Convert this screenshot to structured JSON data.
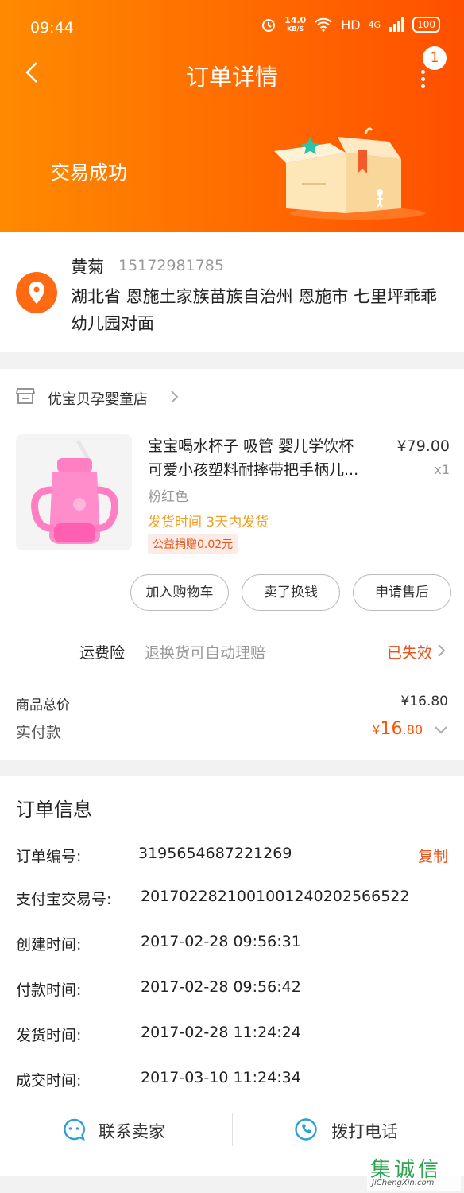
{
  "status_bar": {
    "time": "09:44",
    "speed_value": "14.0",
    "speed_unit": "KB/S",
    "hd": "HD",
    "network": "4G",
    "battery": "100"
  },
  "nav": {
    "title": "订单详情",
    "badge_count": "1"
  },
  "header": {
    "trade_status": "交易成功"
  },
  "address": {
    "name": "黄菊",
    "phone": "15172981785",
    "full": "湖北省 恩施土家族苗族自治州 恩施市 七里坪乖乖幼儿园对面"
  },
  "shop": {
    "name": "优宝贝孕婴童店"
  },
  "product": {
    "title_line1": "宝宝喝水杯子 吸管 婴儿学饮杯",
    "title_line2": "可爱小孩塑料耐摔带把手柄儿...",
    "price": "¥79.00",
    "quantity": "x1",
    "sku": "粉红色",
    "ship_time": "发货时间  3天内发货",
    "charity": "公益捐赠0.02元"
  },
  "actions": {
    "add_to_cart": "加入购物车",
    "resell": "卖了换钱",
    "after_sale": "申请售后"
  },
  "insurance": {
    "label": "运费险",
    "desc": "退换货可自动理赔",
    "status": "已失效"
  },
  "totals": {
    "goods_label": "商品总价",
    "goods_value": "¥16.80",
    "paid_label": "实付款",
    "paid_currency": "¥",
    "paid_int": "16",
    "paid_dec": ".80"
  },
  "order_info": {
    "title": "订单信息",
    "copy_label": "复制",
    "rows": [
      {
        "label": "订单编号:",
        "value": "3195654687221269"
      },
      {
        "label": "支付宝交易号:",
        "value": "2017022821001001240202566522"
      },
      {
        "label": "创建时间:",
        "value": "2017-02-28 09:56:31"
      },
      {
        "label": "付款时间:",
        "value": "2017-02-28 09:56:42"
      },
      {
        "label": "发货时间:",
        "value": "2017-02-28 11:24:24"
      },
      {
        "label": "成交时间:",
        "value": "2017-03-10 11:24:34"
      }
    ]
  },
  "contact": {
    "seller": "联系卖家",
    "call": "拨打电话"
  },
  "watermark": {
    "top": "集诚信",
    "bottom": "JiChengXin.com"
  },
  "colors": {
    "brand_orange": "#ff6a00",
    "accent_red": "#e8541e",
    "ship_yellow": "#f0a020",
    "contact_blue": "#2a9fd8"
  }
}
